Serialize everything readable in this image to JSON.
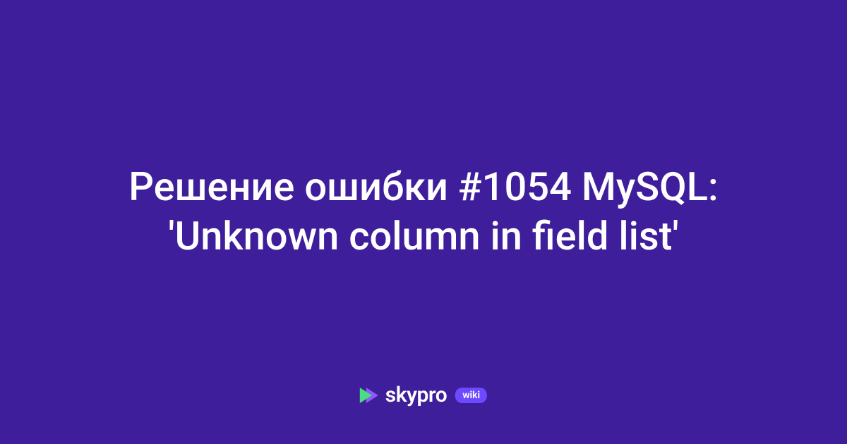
{
  "title": "Решение ошибки #1054 MySQL: 'Unknown column in field list'",
  "logo": {
    "text": "skypro",
    "badge": "wiki"
  },
  "colors": {
    "background": "#3f1e9c",
    "text": "#ffffff",
    "accent_green": "#4ade80",
    "accent_purple": "#8b5cf6",
    "badge_bg": "#6d4aff"
  }
}
